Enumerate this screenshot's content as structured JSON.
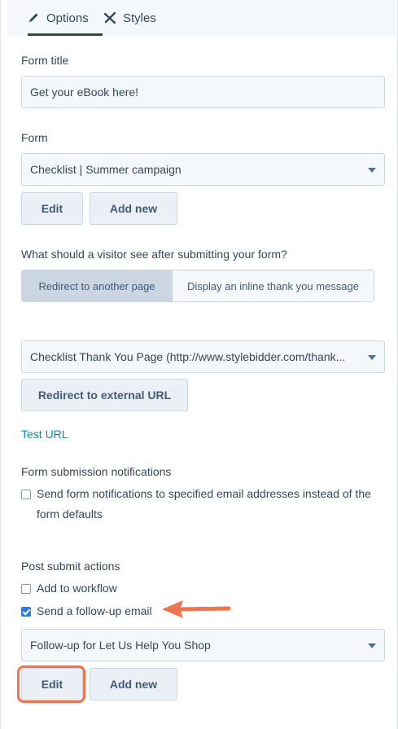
{
  "tabs": [
    {
      "label": "Options",
      "icon": "pencil-icon",
      "active": true
    },
    {
      "label": "Styles",
      "icon": "styles-icon",
      "active": false
    }
  ],
  "form_title": {
    "label": "Form title",
    "value": "Get your eBook here!"
  },
  "form": {
    "label": "Form",
    "selected": "Checklist | Summer campaign",
    "edit_label": "Edit",
    "add_new_label": "Add new"
  },
  "after_submit": {
    "question": "What should a visitor see after submitting your form?",
    "options": [
      "Redirect to another page",
      "Display an inline thank you message"
    ],
    "selected": "Redirect to another page"
  },
  "redirect": {
    "selected_page": "Checklist Thank You Page (http://www.stylebidder.com/thank...",
    "external_url_label": "Redirect to external URL",
    "test_url_label": "Test URL"
  },
  "notifications": {
    "label": "Form submission notifications",
    "checkbox_label": "Send form notifications to specified email addresses instead of the form defaults",
    "checked": false
  },
  "post_submit": {
    "label": "Post submit actions",
    "workflow_label": "Add to workflow",
    "workflow_checked": false,
    "followup_label": "Send a follow-up email",
    "followup_checked": true,
    "followup_selected": "Follow-up for Let Us Help You Shop",
    "edit_label": "Edit",
    "add_new_label": "Add new"
  },
  "colors": {
    "accent_arrow": "#f0744f",
    "link": "#0091ae",
    "checkbox_checked": "#2a7de1"
  }
}
